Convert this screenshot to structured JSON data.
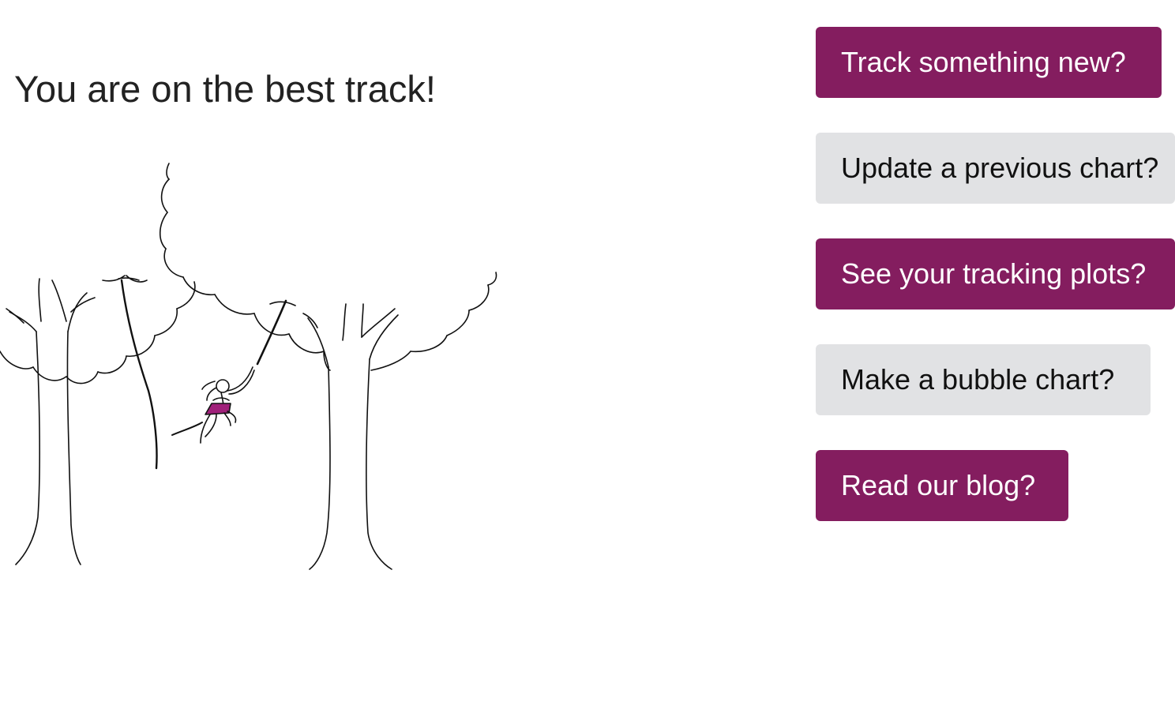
{
  "headline": "You are on the best track!",
  "illustration": {
    "icon": "jungle-vine-swing-illustration",
    "accent_color": "#a0207a"
  },
  "buttons": {
    "track_new": "Track something new?",
    "update_chart": "Update a previous chart?",
    "see_plots": "See your tracking plots?",
    "bubble_chart": "Make a bubble chart?",
    "read_blog": "Read our blog?"
  },
  "colors": {
    "primary": "#841d5f",
    "secondary": "#e1e2e4",
    "text": "#222222"
  }
}
